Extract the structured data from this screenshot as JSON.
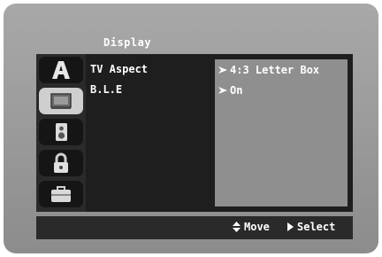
{
  "menu": {
    "section_title": "Display",
    "tabs": [
      {
        "name": "language-tab",
        "icon": "language-A-icon",
        "active": false
      },
      {
        "name": "display-tab",
        "icon": "tv-screen-icon",
        "active": true
      },
      {
        "name": "audio-tab",
        "icon": "speaker-icon",
        "active": false
      },
      {
        "name": "lock-tab",
        "icon": "padlock-icon",
        "active": false
      },
      {
        "name": "others-tab",
        "icon": "briefcase-icon",
        "active": false
      }
    ],
    "settings": [
      {
        "label": "TV Aspect",
        "value": "4:3 Letter Box"
      },
      {
        "label": "B.L.E",
        "value": "On"
      }
    ]
  },
  "footer": {
    "move_label": "Move",
    "select_label": "Select"
  }
}
